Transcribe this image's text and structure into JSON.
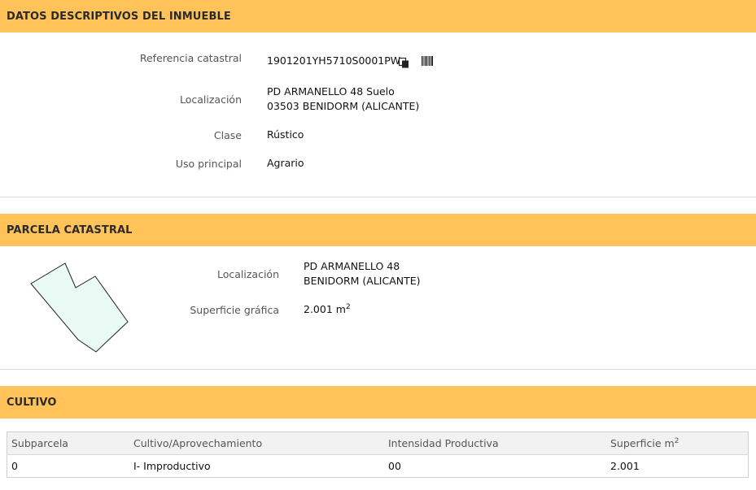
{
  "inmueble": {
    "header": "DATOS DESCRIPTIVOS DEL INMUEBLE",
    "ref_label": "Referencia catastral",
    "ref_value": "1901201YH5710S0001PW",
    "loc_label": "Localización",
    "loc_line1": "PD ARMANELLO 48 Suelo",
    "loc_line2": "03503 BENIDORM (ALICANTE)",
    "clase_label": "Clase",
    "clase_value": "Rústico",
    "uso_label": "Uso principal",
    "uso_value": "Agrario",
    "icons": [
      "copy-icon",
      "barcode-icon"
    ]
  },
  "parcela": {
    "header": "PARCELA CATASTRAL",
    "loc_label": "Localización",
    "loc_line1": "PD ARMANELLO 48",
    "loc_line2": "BENIDORM (ALICANTE)",
    "sup_label": "Superficie gráfica",
    "sup_value": "2.001 m",
    "sup_unit_exp": "2",
    "shape_fill": "#eafbf5"
  },
  "cultivo": {
    "header": "CULTIVO",
    "columns": [
      "Subparcela",
      "Cultivo/Aprovechamiento",
      "Intensidad Productiva",
      "Superficie m"
    ],
    "col3_exp": "2",
    "rows": [
      [
        "0",
        "I- Improductivo",
        "00",
        "2.001"
      ]
    ]
  },
  "colors": {
    "header_bg": "#ffc35a",
    "table_header_bg": "#f2f2f2"
  }
}
